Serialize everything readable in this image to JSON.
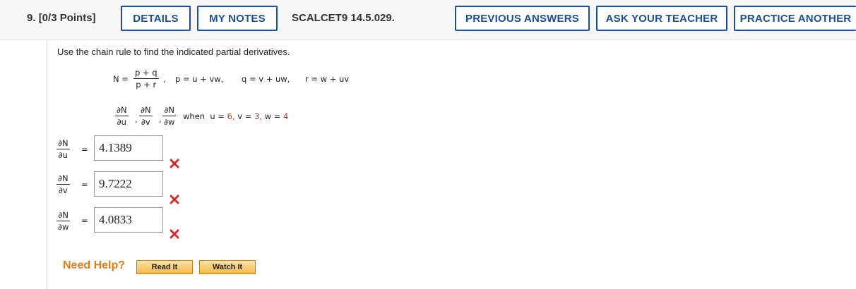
{
  "header": {
    "question_number": "9.",
    "points": "[0/3 Points]",
    "details_label": "DETAILS",
    "my_notes_label": "MY NOTES",
    "assignment_code": "SCALCET9 14.5.029.",
    "previous_answers_label": "PREVIOUS ANSWERS",
    "ask_teacher_label": "ASK YOUR TEACHER",
    "practice_another_label": "PRACTICE ANOTHER"
  },
  "problem": {
    "prompt": "Use the chain rule to find the indicated partial derivatives.",
    "N_lhs": "N =",
    "N_num": "p + q",
    "N_den": "p + r",
    "comma1": ",",
    "p_def": "p = u + vw,",
    "q_def": "q = v + uw,",
    "r_def": "r = w + uv",
    "dN": "∂N",
    "du": "∂u",
    "dv": "∂v",
    "dw": "∂w",
    "comma": ",",
    "when": "when",
    "u_eq": "u =",
    "u_val": "6,",
    "v_eq": "v =",
    "v_val": "3,",
    "w_eq": "w =",
    "w_val": "4"
  },
  "answers": [
    {
      "value": "4.1389",
      "status": "incorrect"
    },
    {
      "value": "9.7222",
      "status": "incorrect"
    },
    {
      "value": "4.0833",
      "status": "incorrect"
    }
  ],
  "equals_sign": "=",
  "help": {
    "label": "Need Help?",
    "read_it_label": "Read It",
    "watch_it_label": "Watch It"
  },
  "colors": {
    "brand_blue": "#1f4f8f",
    "incorrect_red": "#d62b2b",
    "help_orange": "#e07b1a",
    "given_value_red": "#c0392b"
  }
}
